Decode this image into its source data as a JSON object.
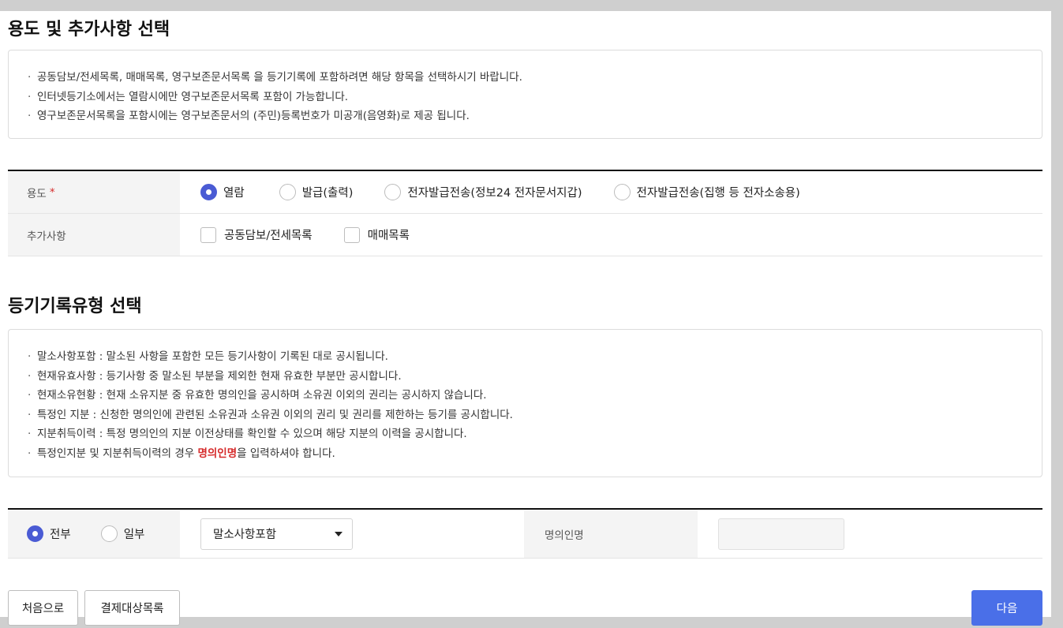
{
  "usage_section": {
    "title": "용도 및 추가사항 선택",
    "notices": [
      "공동담보/전세목록, 매매목록, 영구보존문서목록 을 등기기록에 포함하려면 해당 항목을 선택하시기 바랍니다.",
      "인터넷등기소에서는 열람시에만 영구보존문서목록 포함이 가능합니다.",
      "영구보존문서목록을 포함시에는 영구보존문서의 (주민)등록번호가 미공개(음영화)로 제공 됩니다."
    ],
    "usage_label": "용도",
    "required_mark": "*",
    "usage_options": [
      "열람",
      "발급(출력)",
      "전자발급전송(정보24 전자문서지갑)",
      "전자발급전송(집행 등 전자소송용)"
    ],
    "usage_selected": "열람",
    "extra_label": "추가사항",
    "extra_options": [
      "공동담보/전세목록",
      "매매목록"
    ]
  },
  "record_section": {
    "title": "등기기록유형 선택",
    "notices": [
      "말소사항포함 : 말소된 사항을 포함한 모든 등기사항이 기록된 대로 공시됩니다.",
      "현재유효사항 : 등기사항 중 말소된 부분을 제외한 현재 유효한 부분만 공시합니다.",
      "현재소유현황 : 현재 소유지분 중 유효한 명의인을 공시하며 소유권 이외의 권리는 공시하지 않습니다.",
      "특정인 지분 : 신청한 명의인에 관련된 소유권과 소유권 이외의 권리 및 권리를 제한하는 등기를 공시합니다.",
      "지분취득이력 : 특정 명의인의 지분 이전상태를 확인할 수 있으며 해당 지분의 이력을 공시합니다."
    ],
    "last_notice_before": "특정인지분 및 지분취득이력의 경우 ",
    "last_notice_highlight": "명의인명",
    "last_notice_after": "을 입력하셔야 합니다.",
    "scope_options": [
      "전부",
      "일부"
    ],
    "scope_selected": "전부",
    "type_select_value": "말소사항포함",
    "owner_name_label": "명의인명",
    "owner_name_value": ""
  },
  "buttons": {
    "home": "처음으로",
    "payment_list": "결제대상목록",
    "next": "다음"
  },
  "colors": {
    "accent": "#4a5bd4",
    "primary_button": "#4a6fe8",
    "highlight": "#d62b2b"
  }
}
